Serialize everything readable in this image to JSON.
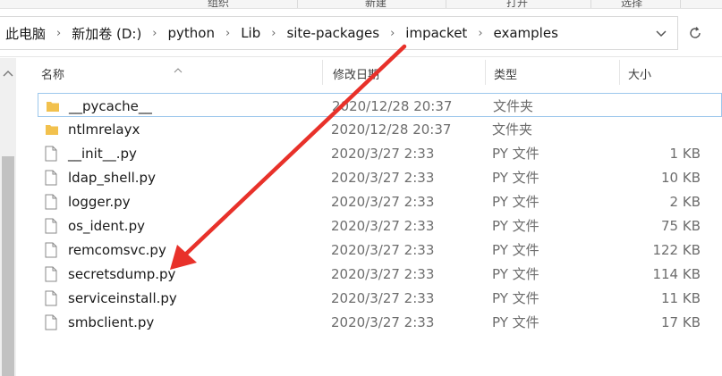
{
  "ribbon": {
    "labels": [
      "组织",
      "新建",
      "打开",
      "选择"
    ]
  },
  "address_bar": {
    "breadcrumbs": [
      "此电脑",
      "新加卷 (D:)",
      "python",
      "Lib",
      "site-packages",
      "impacket",
      "examples"
    ],
    "dropdown_icon": "chevron-down-icon",
    "refresh_icon": "refresh-icon"
  },
  "columns": {
    "name": "名称",
    "modified": "修改日期",
    "type": "类型",
    "size": "大小"
  },
  "files": [
    {
      "name": "__pycache__",
      "modified": "2020/12/28 20:37",
      "type": "文件夹",
      "size": "",
      "kind": "folder",
      "selected": true
    },
    {
      "name": "ntlmrelayx",
      "modified": "2020/12/28 20:37",
      "type": "文件夹",
      "size": "",
      "kind": "folder",
      "selected": false
    },
    {
      "name": "__init__.py",
      "modified": "2020/3/27 2:33",
      "type": "PY 文件",
      "size": "1 KB",
      "kind": "file",
      "selected": false
    },
    {
      "name": "ldap_shell.py",
      "modified": "2020/3/27 2:33",
      "type": "PY 文件",
      "size": "10 KB",
      "kind": "file",
      "selected": false
    },
    {
      "name": "logger.py",
      "modified": "2020/3/27 2:33",
      "type": "PY 文件",
      "size": "2 KB",
      "kind": "file",
      "selected": false
    },
    {
      "name": "os_ident.py",
      "modified": "2020/3/27 2:33",
      "type": "PY 文件",
      "size": "75 KB",
      "kind": "file",
      "selected": false
    },
    {
      "name": "remcomsvc.py",
      "modified": "2020/3/27 2:33",
      "type": "PY 文件",
      "size": "122 KB",
      "kind": "file",
      "selected": false
    },
    {
      "name": "secretsdump.py",
      "modified": "2020/3/27 2:33",
      "type": "PY 文件",
      "size": "114 KB",
      "kind": "file",
      "selected": false
    },
    {
      "name": "serviceinstall.py",
      "modified": "2020/3/27 2:33",
      "type": "PY 文件",
      "size": "11 KB",
      "kind": "file",
      "selected": false
    },
    {
      "name": "smbclient.py",
      "modified": "2020/3/27 2:33",
      "type": "PY 文件",
      "size": "17 KB",
      "kind": "file",
      "selected": false
    }
  ],
  "colors": {
    "folder": "#f2c14e",
    "selection_border": "#9cc7ec",
    "annotation_arrow": "#e8312a"
  }
}
